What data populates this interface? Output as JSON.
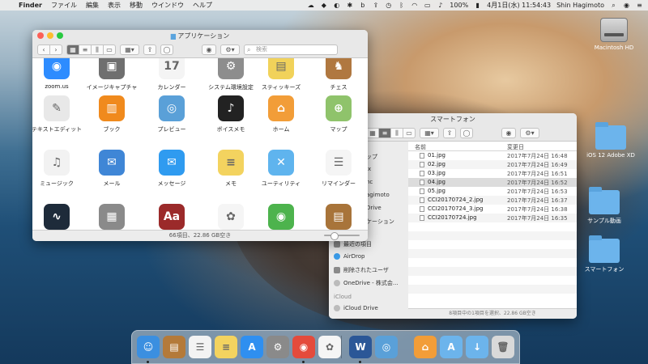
{
  "menubar": {
    "finder": "Finder",
    "items": [
      "ファイル",
      "編集",
      "表示",
      "移動",
      "ウインドウ",
      "ヘルプ"
    ],
    "battery": "100%",
    "datetime": "4月1日(水)  11:54:43",
    "user": "Shin Hagimoto"
  },
  "desktop": {
    "items": [
      {
        "label": "Macintosh HD",
        "icon": "hard-drive-icon"
      },
      {
        "label": "iOS 12 Adobe XD",
        "icon": "folder-icon"
      },
      {
        "label": "サンプル動画",
        "icon": "folder-icon"
      },
      {
        "label": "スマートフォン",
        "icon": "folder-icon"
      }
    ]
  },
  "apps_window": {
    "title": "アプリケーション",
    "search_placeholder": "検索",
    "status": "66項目、22.86 GB空き",
    "rows": [
      [
        {
          "label": "zoom.us",
          "color": "#2d8cff",
          "glyph": "◉"
        },
        {
          "label": "イメージキャプチャ",
          "color": "#6f6f6f",
          "glyph": "▣"
        },
        {
          "label": "カレンダー",
          "color": "#f4f4f4",
          "glyph": "17"
        },
        {
          "label": "システム環境設定",
          "color": "#8d8d8d",
          "glyph": "⚙"
        },
        {
          "label": "スティッキーズ",
          "color": "#f1d25a",
          "glyph": "▤"
        },
        {
          "label": "チェス",
          "color": "#b07840",
          "glyph": "♞"
        }
      ],
      [
        {
          "label": "テキストエディット",
          "color": "#e8e8e8",
          "glyph": "✎"
        },
        {
          "label": "ブック",
          "color": "#f08a1d",
          "glyph": "▥"
        },
        {
          "label": "プレビュー",
          "color": "#5aa0d8",
          "glyph": "◎"
        },
        {
          "label": "ボイスメモ",
          "color": "#222222",
          "glyph": "♪"
        },
        {
          "label": "ホーム",
          "color": "#f29d38",
          "glyph": "⌂"
        },
        {
          "label": "マップ",
          "color": "#8fc36b",
          "glyph": "⊕"
        }
      ],
      [
        {
          "label": "ミュージック",
          "color": "#f2f2f2",
          "glyph": "♫"
        },
        {
          "label": "メール",
          "color": "#3f86d6",
          "glyph": "✉"
        },
        {
          "label": "メッセージ",
          "color": "#2f9bf0",
          "glyph": "✉"
        },
        {
          "label": "メモ",
          "color": "#f3d35f",
          "glyph": "≡"
        },
        {
          "label": "ユーティリティ",
          "color": "#5fb4ee",
          "glyph": "✕"
        },
        {
          "label": "リマインダー",
          "color": "#f5f5f5",
          "glyph": "☰"
        }
      ],
      [
        {
          "label": "",
          "color": "#1e2b3a",
          "glyph": "∿"
        },
        {
          "label": "",
          "color": "#8a8a8a",
          "glyph": "▦"
        },
        {
          "label": "",
          "color": "#9b2a2a",
          "glyph": "Aa"
        },
        {
          "label": "",
          "color": "#f5f5f5",
          "glyph": "✿"
        },
        {
          "label": "",
          "color": "#4db34d",
          "glyph": "◉"
        },
        {
          "label": "",
          "color": "#a8743a",
          "glyph": "▤"
        }
      ]
    ]
  },
  "phone_window": {
    "title": "スマートフォン",
    "col_name": "名前",
    "col_date": "変更日",
    "status": "8項目中の1項目を選択、22.86 GB空き",
    "sidebar": {
      "partial": [
        "ップ",
        "ix",
        "nc",
        "agimoto",
        "Drive",
        "ケーション"
      ],
      "items": [
        "最近の項目",
        "AirDrop",
        "削除されたユーザ",
        "OneDrive - 株式会..."
      ],
      "icloud_header": "iCloud",
      "icloud_item": "iCloud Drive"
    },
    "files": [
      {
        "name": "01.jpg",
        "date": "2017年7月24日 16:48"
      },
      {
        "name": "02.jpg",
        "date": "2017年7月24日 16:49"
      },
      {
        "name": "03.jpg",
        "date": "2017年7月24日 16:51"
      },
      {
        "name": "04.jpg",
        "date": "2017年7月24日 16:52"
      },
      {
        "name": "05.jpg",
        "date": "2017年7月24日 16:53"
      },
      {
        "name": "CCI20170724_2.jpg",
        "date": "2017年7月24日 16:37"
      },
      {
        "name": "CCI20170724_3.jpg",
        "date": "2017年7月24日 16:38"
      },
      {
        "name": "CCI20170724.jpg",
        "date": "2017年7月24日 16:35"
      }
    ]
  },
  "dock": {
    "items": [
      {
        "name": "finder",
        "color": "#3b8fe0",
        "glyph": "☺"
      },
      {
        "name": "notefile",
        "color": "#b47a3a",
        "glyph": "▤"
      },
      {
        "name": "reminders",
        "color": "#f3f3f3",
        "glyph": "☰"
      },
      {
        "name": "notes",
        "color": "#f3d35f",
        "glyph": "≡"
      },
      {
        "name": "app-store",
        "color": "#2f8ff0",
        "glyph": "A"
      },
      {
        "name": "system-preferences",
        "color": "#8a8a8a",
        "glyph": "⚙"
      },
      {
        "name": "chrome",
        "color": "#e44b3c",
        "glyph": "◉"
      },
      {
        "name": "photos",
        "color": "#f5f5f5",
        "glyph": "✿"
      },
      {
        "name": "word",
        "color": "#2b5797",
        "glyph": "W"
      },
      {
        "name": "preview",
        "color": "#5aa0d8",
        "glyph": "◎"
      },
      {
        "name": "home",
        "color": "#f29d38",
        "glyph": "⌂"
      },
      {
        "name": "applications-folder",
        "color": "#6cb4ec",
        "glyph": "A"
      },
      {
        "name": "downloads-folder",
        "color": "#6cb4ec",
        "glyph": "↓"
      },
      {
        "name": "trash",
        "color": "#d9d9d9",
        "glyph": "🗑"
      }
    ]
  }
}
